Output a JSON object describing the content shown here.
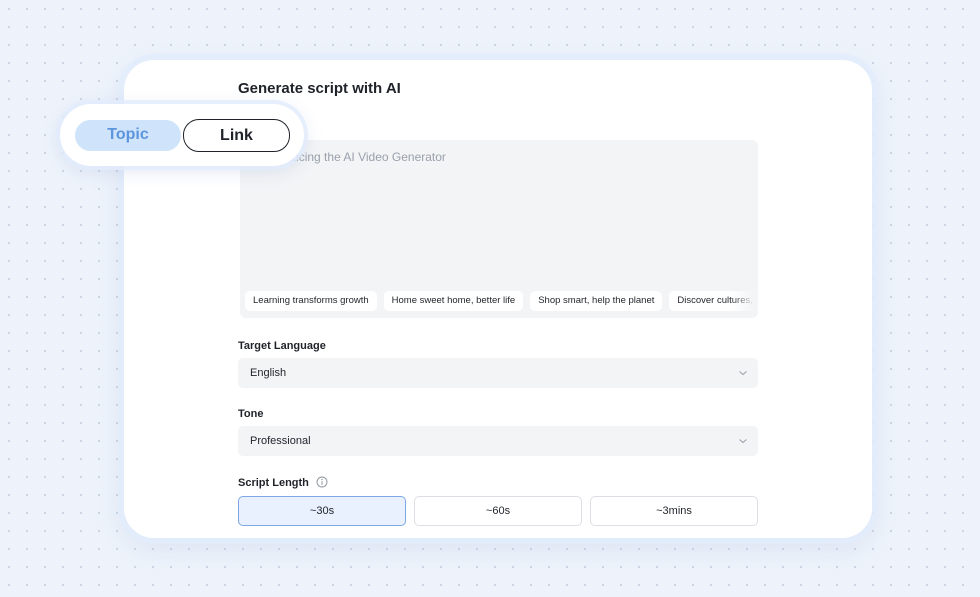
{
  "header": {
    "title": "Generate script with AI"
  },
  "mode_tabs": [
    {
      "label": "Topic",
      "active": true
    },
    {
      "label": "Link",
      "active": false
    }
  ],
  "topic_input": {
    "placeholder": "e.g. Introducing the AI Video Generator",
    "suggestions": [
      "Learning transforms growth",
      "Home sweet home, better life",
      "Shop smart, help the planet",
      "Discover cultures, explore the world"
    ]
  },
  "target_language": {
    "label": "Target Language",
    "value": "English"
  },
  "tone": {
    "label": "Tone",
    "value": "Professional"
  },
  "script_length": {
    "label": "Script Length",
    "options": [
      {
        "label": "~30s",
        "selected": true
      },
      {
        "label": "~60s",
        "selected": false
      },
      {
        "label": "~3mins",
        "selected": false
      }
    ]
  },
  "icons": {
    "dropdown": "chevron-down-icon",
    "help": "info-icon"
  },
  "colors": {
    "accent": "#5c95dd",
    "active_tab_bg": "#cfe4fb",
    "selected_option_bg": "#e8f1fd",
    "selected_option_border": "#7ea7e6",
    "input_bg": "#f2f4f6",
    "page_bg": "#eef3fb"
  }
}
